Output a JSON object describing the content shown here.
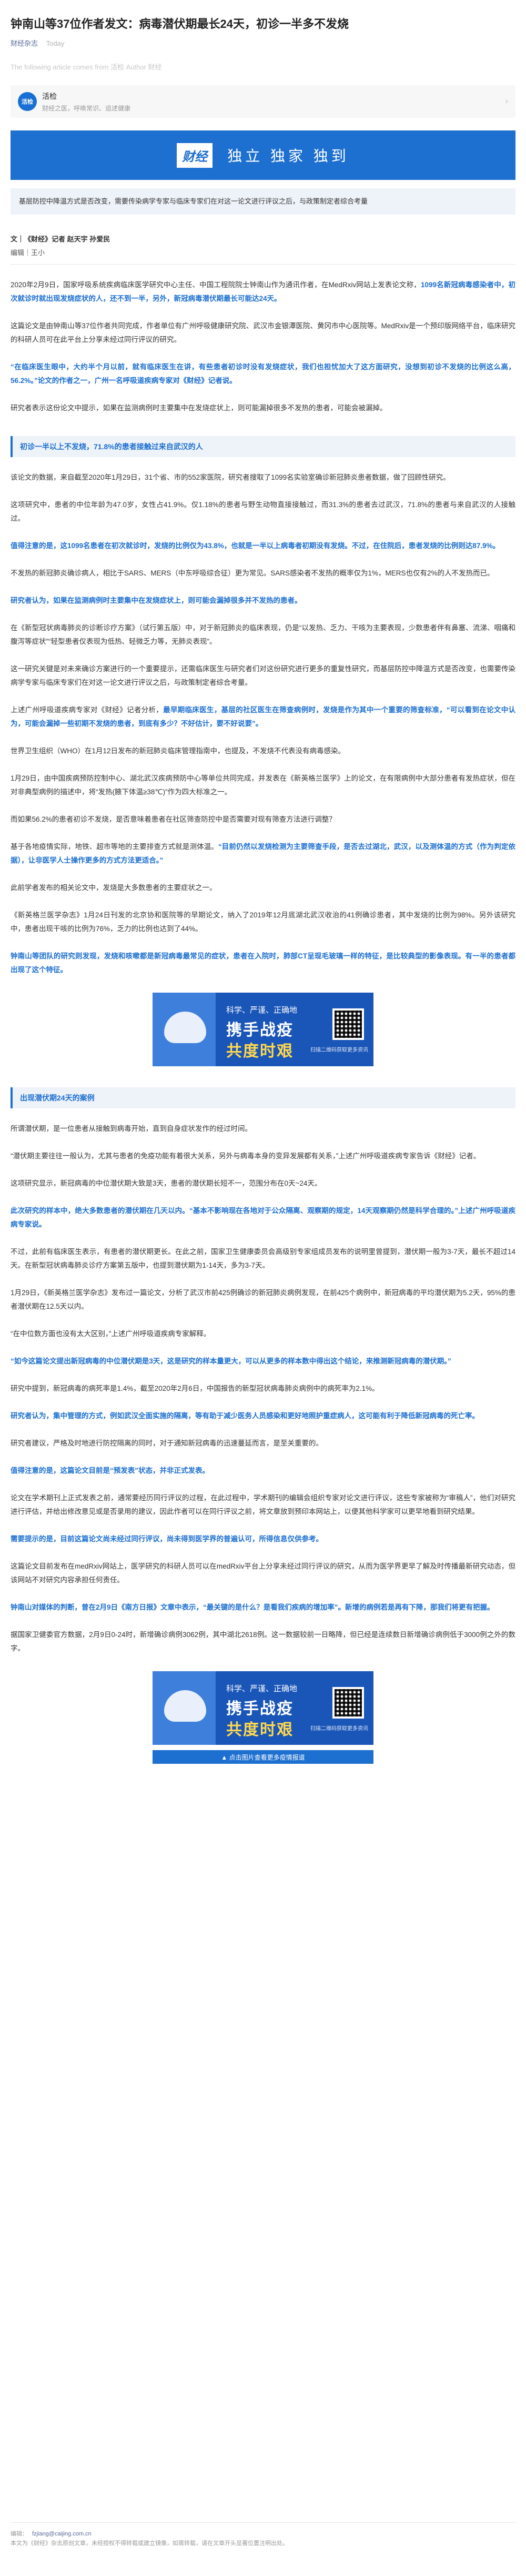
{
  "article": {
    "title": "钟南山等37位作者发文：病毒潜伏期最长24天，初诊一半多不发烧",
    "account": "财经杂志",
    "date": "Today",
    "source_note": "The following article comes from 活检 Author 财经"
  },
  "account_card": {
    "avatar": "活检",
    "name": "活检",
    "desc": "财经之医，呼唤常识、追述健康",
    "arrow": "›"
  },
  "banner": {
    "logo": "财经",
    "slogan": "独立 独家 独到"
  },
  "lead": "基层防控中降温方式是否改变，需要传染病学专家与临床专家们在对这一论文进行评议之后，与政策制定者综合考量",
  "byline": {
    "authors": "文｜《财经》记者 赵天宇 孙爱民",
    "editor": "编辑｜王小"
  },
  "paragraphs": [
    {
      "pre": "2020年2月9日，国家呼吸系统疾病临床医学研究中心主任、中国工程院院士钟南山作为通讯作者，在MedRxiv网站上发表论文称，",
      "hl": "1099名新冠病毒感染者中，初次就诊时就出现发烧症状的人，还不到一半，另外，新冠病毒潜伏期最长可能达24天。"
    },
    {
      "pre": "这篇论文是由钟南山等37位作者共同完成，作者单位有广州呼吸健康研究院、武汉市金银潭医院、黄冈市中心医院等。MedRxiv是一个预印版网络平台，临床研究的科研人员可在此平台上分享未经过同行评议的研究。",
      "hl": ""
    },
    {
      "pre": "",
      "hl": "“在临床医生眼中，大约半个月以前，就有临床医生在讲，有些患者初诊时没有发烧症状，我们也担忧加大了这方面研究，没想到初诊不发烧的比例这么高，56.2%。”论文的作者之一，广州一名呼吸道疾病专家对《财经》记者说。"
    },
    {
      "pre": "研究者表示这份论文中提示，如果在监测病例时主要集中在发烧症状上，则可能漏掉很多不发热的患者，可能会被漏掉。",
      "hl": ""
    }
  ],
  "section1": "初诊一半以上不发烧，71.8%的患者接触过来自武汉的人",
  "paragraphs2": [
    {
      "pre": "该论文的数据，来自截至2020年1月29日，31个省、市的552家医院，研究者搜取了1099名实验室确诊新冠肺炎患者数据，做了回顾性研究。",
      "hl": ""
    },
    {
      "pre": "这项研究中，患者的中位年龄为47.0岁，女性占41.9%。仅1.18%的患者与野生动物直接接触过，而31.3%的患者去过武汉，71.8%的患者与来自武汉的人接触过。",
      "hl": ""
    },
    {
      "pre": "",
      "hl": "值得注意的是，这1099名患者在初次就诊时，发烧的比例仅为43.8%，也就是一半以上病毒者初期没有发烧。不过，在住院后，患者发烧的比例则达87.9%。"
    },
    {
      "pre": "不发热的新冠肺炎确诊病人，相比于SARS、MERS（中东呼吸综合征）更为常见。SARS感染者不发热的概率仅为1%，MERS也仅有2%的人不发热而已。",
      "hl": ""
    },
    {
      "pre": "",
      "hl": "研究者认为，如果在监测病例时主要集中在发烧症状上，则可能会漏掉很多并不发热的患者。"
    },
    {
      "pre": "在《新型冠状病毒肺炎的诊断诊疗方案》（试行第五版）中，对于新冠肺炎的临床表现，仍是“以发热、乏力、干咳为主要表现，少数患者伴有鼻塞、流涕、咽痛和腹泻等症状”“轻型患者仅表现为低热、轻微乏力等，无肺炎表现”。",
      "hl": ""
    },
    {
      "pre": "这一研究关键是对未来确诊方案进行的一个重要提示，还需临床医生与研究者们对这份研究进行更多的重复性研究，而基层防控中降温方式是否改变，也需要传染病学专家与临床专家们在对这一论文进行评议之后，与政策制定者综合考量。",
      "hl": ""
    },
    {
      "pre": "上述广州呼吸道疾病专家对《财经》记者分析，",
      "hl": "最早期临床医生，基层的社区医生在筛查病例时，发烧是作为其中一个重要的筛查标准，“可以看到在论文中认为，可能会漏掉一些初期不发烧的患者，到底有多少？不好估计，要不好说要”。"
    },
    {
      "pre": "世界卫生组织（WHO）在1月12日发布的新冠肺炎临床管理指南中，也提及，不发烧不代表没有病毒感染。",
      "hl": ""
    },
    {
      "pre": "1月29日，由中国疾病预防控制中心、湖北武汉疾病预防中心等单位共同完成，并发表在《新英格兰医学》上的论文，在有限病例中大部分患者有发热症状，但在对非典型病例的描述中，将“发热(腋下体温≥38℃)”作为四大标准之一。",
      "hl": ""
    },
    {
      "pre": "而如果56.2%的患者初诊不发烧，是否意味着患者在社区筛查防控中是否需要对现有筛查方法进行调整？",
      "hl": ""
    },
    {
      "pre": "基于各地疫情实际，地铁、超市等地的主要排查方式就是测体温。",
      "hl": "“目前仍然以发烧检测为主要筛查手段，是否去过湖北，武汉，以及测体温的方式（作为判定依据），让非医学人士操作更多的方式方法更适合。”"
    },
    {
      "pre": "此前学者发布的相关论文中，发烧是大多数患者的主要症状之一。",
      "hl": ""
    },
    {
      "pre": "《新英格兰医学杂志》1月24日刊发的北京协和医院等的早期论文，纳入了2019年12月底湖北武汉收治的41例确诊患者，其中发烧的比例为98%。另外该研究中，患者出现干咳的比例为76%，乏力的比例也达到了44%。",
      "hl": ""
    },
    {
      "pre": "",
      "hl": "钟南山等团队的研究则发现，发烧和咳嗽都是新冠病毒最常见的症状，患者在入院时，肺部CT呈现毛玻璃一样的特征，是比较典型的影像表现。有一半的患者都出现了这个特征。"
    }
  ],
  "ad1": {
    "line1": "科学、严谨、正确地",
    "line2": "携手战疫",
    "line3": "共度时艰",
    "qr_caption": "扫描二维码获取更多资讯"
  },
  "section2": "出现潜伏期24天的案例",
  "paragraphs3": [
    {
      "pre": "所谓潜伏期，是一位患者从接触到病毒开始，直到自身症状发作的经过时间。",
      "hl": ""
    },
    {
      "pre": "“潜伏期主要往往一般认为，尤其与患者的免疫功能有着很大关系，另外与病毒本身的变异发展都有关系，”上述广州呼吸道疾病专家告诉《财经》记者。",
      "hl": ""
    },
    {
      "pre": "这项研究显示，新冠病毒的中位潜伏期大致是3天，患者的潜伏期长短不一，范围分布在0天~24天。",
      "hl": ""
    },
    {
      "pre": "",
      "hl": "此次研究的样本中，绝大多数患者的潜伏期在几天以内。“基本不影响现在各地对于公众隔离、观察期的规定，14天观察期仍然是科学合理的。”上述广州呼吸道疾病专家说。"
    },
    {
      "pre": "不过，此前有临床医生表示，有患者的潜伏期更长。在此之前，国家卫生健康委员会高级别专家组成员发布的说明里曾提到，潜伏期一般为3-7天，最长不超过14天。在新型冠状病毒肺炎诊疗方案第五版中，也提到潜伏期为1-14天，多为3-7天。",
      "hl": ""
    },
    {
      "pre": "1月29日，《新英格兰医学杂志》发布过一篇论文，分析了武汉市前425例确诊的新冠肺炎病例发现，在前425个病例中，新冠病毒的平均潜伏期为5.2天，95%的患者潜伏期在12.5天以内。",
      "hl": ""
    },
    {
      "pre": "“在中位数方面也没有太大区别，”上述广州呼吸道疾病专家解释。",
      "hl": ""
    },
    {
      "pre": "",
      "hl": "“如今这篇论文提出新冠病毒的中位潜伏期是3天，这是研究的样本量更大，可以从更多的样本数中得出这个结论，来推测新冠病毒的潜伏期。”"
    },
    {
      "pre": "研究中提到，新冠病毒的病死率是1.4%，截至2020年2月6日，中国报告的新型冠状病毒肺炎病例中的病死率为2.1%。",
      "hl": ""
    },
    {
      "pre": "",
      "hl": "研究者认为，集中管理的方式，例如武汉全面实施的隔离，等有助于减少医务人员感染和更好地照护重症病人，这可能有利于降低新冠病毒的死亡率。"
    },
    {
      "pre": "研究者建议，严格及时地进行防控隔离的同时，对于通知新冠病毒的迅速蔓延而言，是至关重要的。",
      "hl": ""
    },
    {
      "pre": "",
      "hl": "值得注意的是，这篇论文目前是“预发表”状态，并非正式发表。"
    },
    {
      "pre": "论文在学术期刊上正式发表之前，通常要经历同行评议的过程，在此过程中，学术期刊的编辑会组织专家对论文进行评议，这些专家被称为“审稿人”，他们对研究进行评估，并给出修改意见或是否录用的建议，因此作者可以在同行评议之前，将文章放到预印本网站上，以便其他科学家可以更早地看到研究结果。",
      "hl": ""
    },
    {
      "pre": "",
      "hl": "需要提示的是，目前这篇论文尚未经过同行评议，尚未得到医学界的普遍认可，所得信息仅供参考。"
    },
    {
      "pre": "这篇论文目前发布在medRxiv网站上，医学研究的科研人员可以在medRxiv平台上分享未经过同行评议的研究，从而为医学界更早了解及时传播最新研究动态，但该网站不对研究内容承担任何责任。",
      "hl": ""
    },
    {
      "pre": "",
      "hl": "钟南山对媒体的判断，曾在2月9日《南方日报》文章中表示，“最关键的是什么？是看我们疾病的增加率”。新增的病例若是再有下降，那我们将更有把握。"
    },
    {
      "pre": "据国家卫健委官方数据，2月9日0-24时，新增确诊病例3062例，其中湖北2618例。这一数据较前一日略降，但已经是连续数日新增确诊病例低于3000例之外的数字。",
      "hl": ""
    }
  ],
  "ad2": {
    "line1": "科学、严谨、正确地",
    "line2": "携手战疫",
    "line3": "共度时艰",
    "qr_caption": "扫描二维码获取更多资讯"
  },
  "ad_caption": "▲ 点击图片查看更多疫情报道",
  "footer": {
    "line1_label": "编辑：",
    "line1_value": "fzjiang@caijing.com.cn",
    "line2": "本文为《财经》杂志原创文章，未经授权不得转载或建立镜像，如需转载，请在文章开头显著位置注明出处。"
  }
}
